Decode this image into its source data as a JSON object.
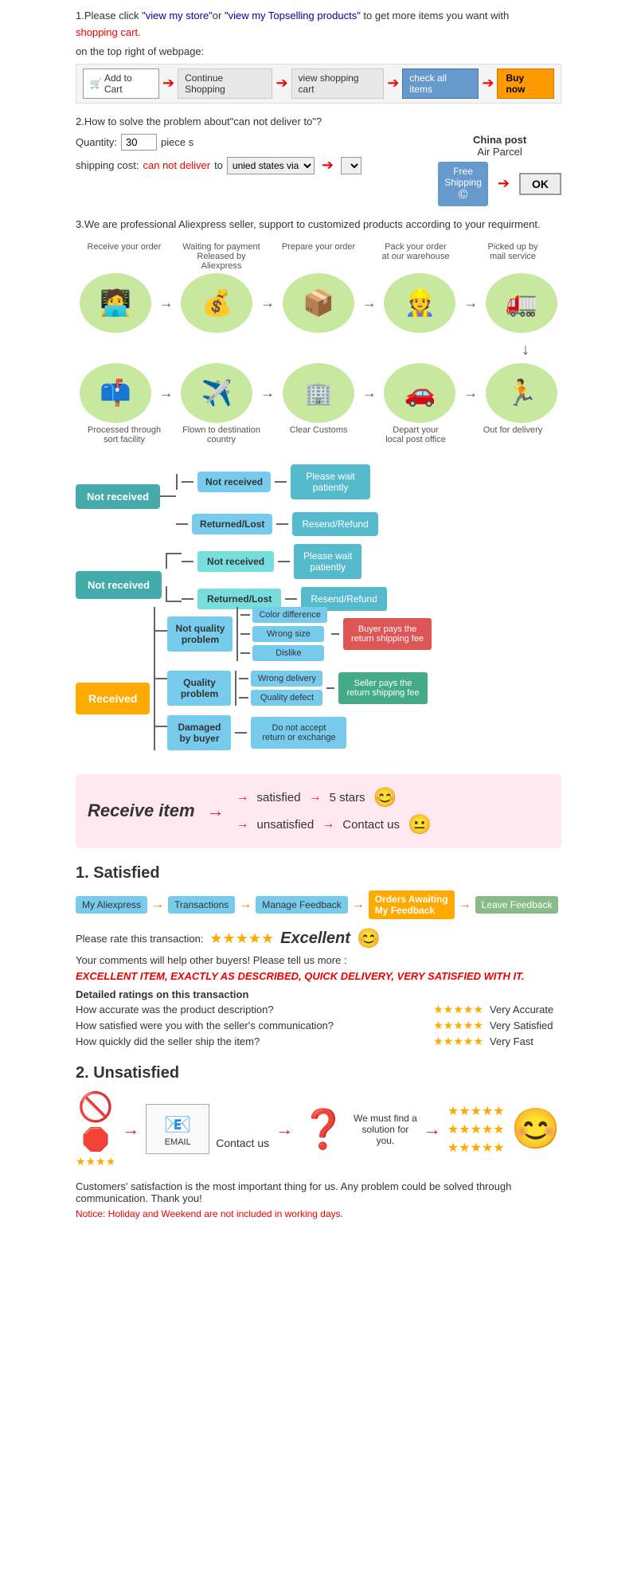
{
  "step1": {
    "text1": "1.Please click ",
    "link1": "\"view my store\"",
    "or_text": "or ",
    "link2": "\"view my Topselling products\"",
    "text2": " to get more items you want with",
    "text3": "shopping cart.",
    "text4": "on the top right of webpage:",
    "cart_steps": [
      {
        "label": "Add to Cart",
        "icon": "🛒",
        "type": "cart"
      },
      {
        "label": "Continue Shopping",
        "type": "normal"
      },
      {
        "label": "view shopping cart",
        "type": "normal"
      },
      {
        "label": "check all items",
        "type": "check"
      },
      {
        "label": "Buy now",
        "type": "buynow"
      }
    ]
  },
  "step2": {
    "title": "2.How to solve the problem about\"can not deliver to\"?",
    "qty_label": "Quantity:",
    "qty_value": "30",
    "qty_suffix": "piece s",
    "shipping_label": "shipping cost:",
    "cannot_deliver": "can not deliver",
    "to_text": " to ",
    "unied_states": "unied states via",
    "china_post": "China post",
    "air_parcel": "Air Parcel",
    "free_shipping": "Free",
    "shipping_text": "Shipping",
    "ok_label": "OK"
  },
  "step3": {
    "text": "3.We are professional Aliexpress seller, support to customized products according to your requirment."
  },
  "flow": {
    "row1": [
      {
        "label": "Receive your order",
        "icon": "🧑‍💻"
      },
      {
        "label": "Waiting for payment\nReleased by Aliexpress",
        "icon": "💰"
      },
      {
        "label": "Prepare your order",
        "icon": "📦"
      },
      {
        "label": "Pack your order\nat our warehouse",
        "icon": "👷"
      },
      {
        "label": "Picked up by\nmail service",
        "icon": "🚛"
      }
    ],
    "row2": [
      {
        "label": "Out for delivery",
        "icon": "🏃"
      },
      {
        "label": "Depart your\nlocal post office",
        "icon": "🚗"
      },
      {
        "label": "Clear Customs",
        "icon": "🏢"
      },
      {
        "label": "Flown to destination\ncountry",
        "icon": "✈️"
      },
      {
        "label": "Processed through\nsort facility",
        "icon": "📫"
      }
    ]
  },
  "not_received_tree": {
    "main": "Not received",
    "branches": [
      {
        "issue": "Not received",
        "result": "Please wait\npatiently"
      },
      {
        "issue": "Returned/Lost",
        "result": "Resend/Refund"
      }
    ]
  },
  "received_tree": {
    "main": "Received",
    "branches": [
      {
        "issue": "Not quality\nproblem",
        "sub_issues": [
          "Color difference",
          "Wrong size",
          "Dislike"
        ],
        "outcome": "Buyer pays the\nreturn shipping fee"
      },
      {
        "issue": "Quality\nproblem",
        "sub_issues": [
          "Wrong delivery",
          "Quality defect"
        ],
        "outcome": "Seller pays the\nreturn shipping fee"
      },
      {
        "issue": "Damaged\nby buyer",
        "result": "Do not accept\nreturn or exchange"
      }
    ]
  },
  "satisfaction": {
    "receive_item": "Receive item",
    "satisfied": "satisfied",
    "unsatisfied": "unsatisfied",
    "five_stars": "5 stars",
    "contact_us": "Contact us",
    "face_happy": "😊",
    "face_neutral": "😐"
  },
  "satisfied_section": {
    "title": "1.  Satisfied",
    "steps": [
      {
        "label": "My Aliexpress",
        "type": "normal"
      },
      {
        "label": "Transactions",
        "type": "normal"
      },
      {
        "label": "Manage Feedback",
        "type": "normal"
      },
      {
        "label": "Orders Awaiting\nMy Feedback",
        "type": "highlight"
      },
      {
        "label": "Leave Feedback",
        "type": "last"
      }
    ],
    "rate_text": "Please rate this transaction:",
    "stars": "★★★★★",
    "excellent": "Excellent",
    "smiley": "😊",
    "comments": "Your comments will help other buyers! Please tell us more :",
    "excellent_item": "EXCELLENT ITEM, EXACTLY AS DESCRIBED, QUICK DELIVERY, VERY SATISFIED WITH IT.",
    "detailed": "Detailed ratings on this transaction",
    "ratings": [
      {
        "label": "How accurate was the product description?",
        "stars": "★★★★★",
        "result": "Very Accurate"
      },
      {
        "label": "How satisfied were you with the seller's communication?",
        "stars": "★★★★★",
        "result": "Very Satisfied"
      },
      {
        "label": "How quickly did the seller ship the item?",
        "stars": "★★★★★",
        "result": "Very Fast"
      }
    ]
  },
  "unsatisfied_section": {
    "title": "2.  Unsatisfied",
    "contact_us": "Contact us",
    "find_solution": "We must find\na solution for\nyou.",
    "notice": "Customers' satisfaction is the most important thing for us. Any problem could be solved through communication. Thank you!",
    "holiday_notice": "Notice: Holiday and Weekend are not included in working days."
  }
}
